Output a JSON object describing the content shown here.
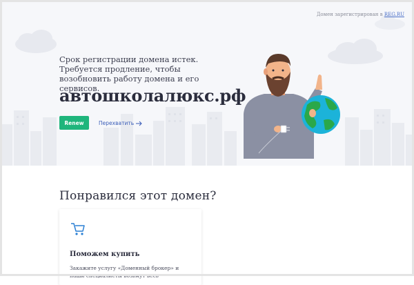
{
  "header": {
    "note_prefix": "Домен зарегистрирован в",
    "registrar_link": "REG.RU"
  },
  "hero": {
    "expired_message": "Срок регистрации домена истек. Требуется продление, чтобы возобновить работу домена и его сервисов.",
    "domain_name": "автошколалюкс.рф",
    "renew_button": "Renew",
    "intercept_link": "Перехватить"
  },
  "offer": {
    "section_title": "Понравился этот домен?",
    "card_title": "Поможем купить",
    "card_text": "Закажите услугу «Доменный брокер» и наши специалисты возьмут весь"
  },
  "colors": {
    "accent_green": "#1fb57c",
    "link_blue": "#3a5db8",
    "hero_background": "#f6f7fa"
  }
}
